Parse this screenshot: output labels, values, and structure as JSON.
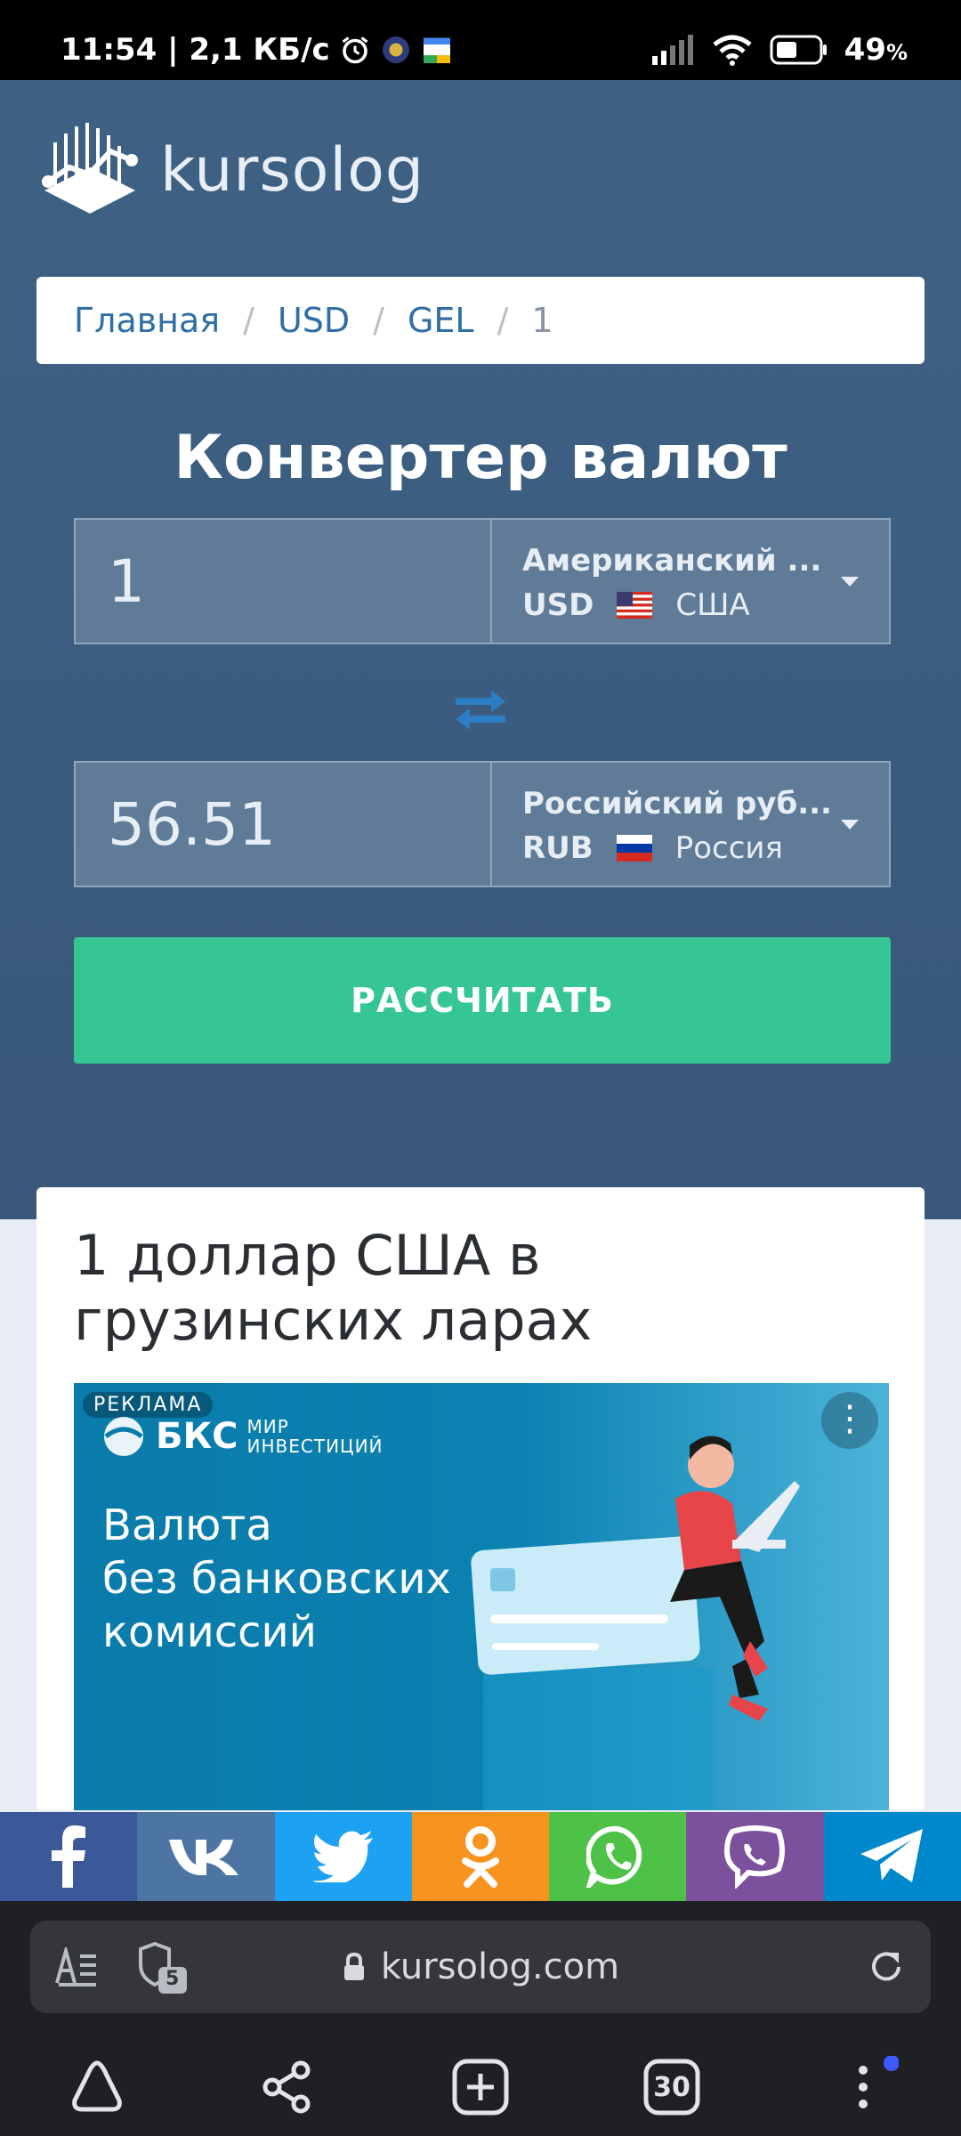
{
  "status": {
    "time_speed": "11:54 | 2,1 КБ/с",
    "battery": "49",
    "battery_unit": "%"
  },
  "brand": {
    "logo_text": "kursolog"
  },
  "breadcrumb": {
    "home": "Главная",
    "from": "USD",
    "to": "GEL",
    "current": "1",
    "sep": "/"
  },
  "converter": {
    "title": "Конвертер валют",
    "from_amount": "1",
    "from_name": "Американский ...",
    "from_code": "USD",
    "from_country": "США",
    "to_amount": "56.51",
    "to_name": "Российский руб...",
    "to_code": "RUB",
    "to_country": "Россия",
    "button": "РАССЧИТАТЬ"
  },
  "card": {
    "title": "1 доллар США в грузинских ларах"
  },
  "ad": {
    "badge": "РЕКЛАМА",
    "brand": "БКС",
    "brand_sub_1": "МИР",
    "brand_sub_2": "ИНВЕСТИЦИЙ",
    "line1": "Валюта",
    "line2": "без банковских",
    "line3": "комиссий"
  },
  "share": [
    {
      "name": "facebook",
      "color": "#3b5998"
    },
    {
      "name": "vk",
      "color": "#4c75a3"
    },
    {
      "name": "twitter",
      "color": "#1da1f2"
    },
    {
      "name": "odnoklassniki",
      "color": "#f7931e"
    },
    {
      "name": "whatsapp",
      "color": "#4dc247"
    },
    {
      "name": "viber",
      "color": "#7b519d"
    },
    {
      "name": "telegram",
      "color": "#0088cc"
    }
  ],
  "browser": {
    "url": "kursolog.com",
    "tabs_badge": "5",
    "tabs_count": "30"
  },
  "colors": {
    "hero": "#3e6183",
    "accent_button": "#35c693",
    "link": "#2f6fa6"
  }
}
